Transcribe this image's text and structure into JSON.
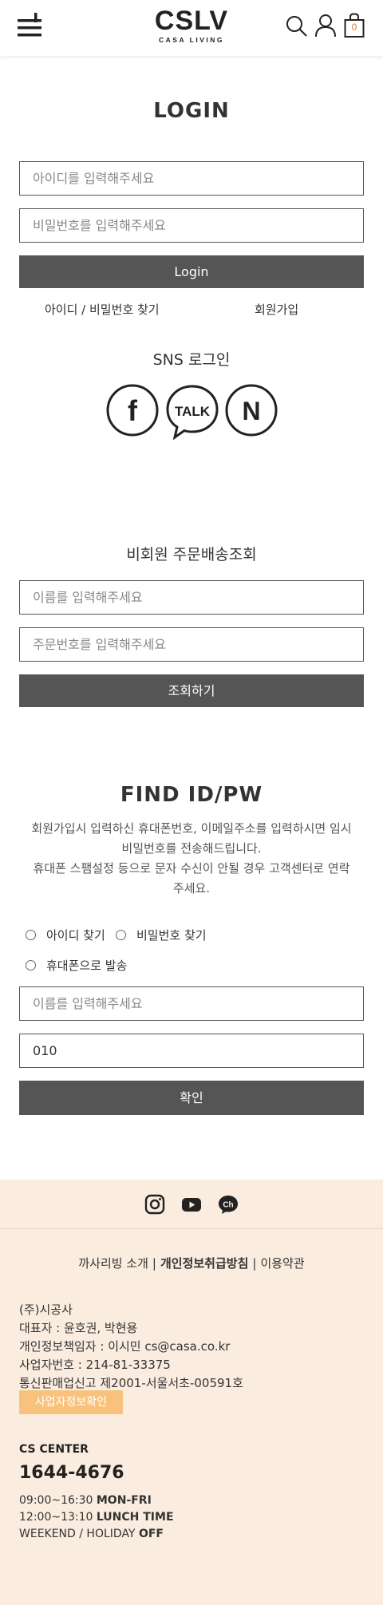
{
  "header": {
    "logo_main": "CSLV",
    "logo_sub": "CASA LIVING",
    "cart_count": "0"
  },
  "login": {
    "title": "LOGIN",
    "id_placeholder": "아이디를 입력해주세요",
    "pw_placeholder": "비밀번호를 입력해주세요",
    "login_button": "Login",
    "find_link": "아이디 / 비밀번호 찾기",
    "join_link": "회원가입",
    "sns_title": "SNS 로그인",
    "sns": [
      {
        "name": "facebook",
        "icon": "facebook-icon",
        "label": "f"
      },
      {
        "name": "kakao talk",
        "icon": "kakaotalk-icon",
        "label": "TALK"
      },
      {
        "name": "naver",
        "icon": "naver-icon",
        "label": "N"
      }
    ]
  },
  "guest": {
    "title": "비회원 주문배송조회",
    "name_placeholder": "이름를 입력해주세요",
    "order_placeholder": "주문번호를 입력해주세요",
    "submit": "조회하기"
  },
  "find": {
    "title": "FIND ID/PW",
    "desc_line1": "회원가입시 입력하신 휴대폰번호, 이메일주소를 입력하시면 임시",
    "desc_line2": "비밀번호를 전송해드립니다.",
    "desc_line3": "휴대폰 스팸설정 등으로 문자 수신이 안될 경우 고객센터로 연락",
    "desc_line4": "주세요.",
    "option_id": "아이디 찾기",
    "option_pw": "비밀번호 찾기",
    "option_phone": "휴대폰으로 발송",
    "name_placeholder": "이름를 입력해주세요",
    "phone_value": "010",
    "confirm": "확인"
  },
  "footer": {
    "links": [
      "까사리빙 소개",
      "개인정보취급방침",
      "이용약관"
    ],
    "company": "(주)시공사",
    "ceo": "대표자 : 윤호권, 박현용",
    "privacy_officer": "개인정보책임자 : 이시민 cs@casa.co.kr",
    "biz_number": "사업자번호 : 214-81-33375",
    "mail_order": "통신판매업신고 제2001-서울서초-00591호",
    "biz_button": "사업자정보확인",
    "cs_title": "CS CENTER",
    "cs_phone": "1644-4676",
    "hours_1_time": "09:00~16:30",
    "hours_1_label": "MON-FRI",
    "hours_2_time": "12:00~13:10",
    "hours_2_label": "LUNCH TIME",
    "hours_3_time": "WEEKEND / HOLIDAY",
    "hours_3_label": "OFF"
  },
  "colors": {
    "button_bg": "#555555",
    "footer_bg": "#faede0",
    "biz_button_bg": "#f9c27c",
    "cart_count": "#e07b39"
  }
}
